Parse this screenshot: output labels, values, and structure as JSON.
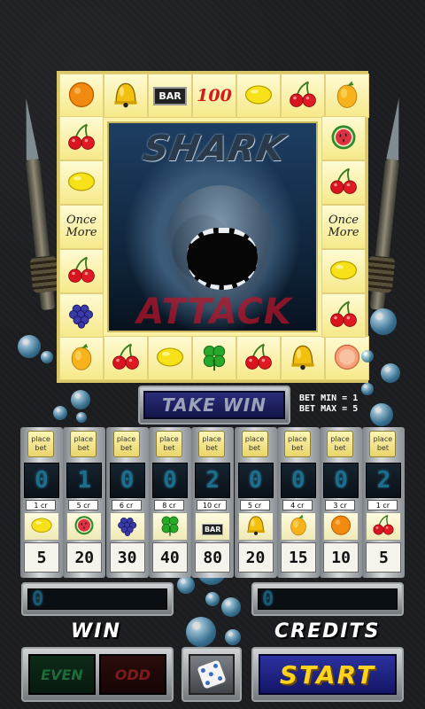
{
  "board": {
    "top": [
      {
        "kind": "icon",
        "icon": "orange-icon"
      },
      {
        "kind": "icon",
        "icon": "bell-icon"
      },
      {
        "kind": "bar",
        "text": "BAR"
      },
      {
        "kind": "num",
        "text": "100"
      },
      {
        "kind": "icon",
        "icon": "lemon-icon"
      },
      {
        "kind": "icon",
        "icon": "cherry-icon"
      },
      {
        "kind": "icon",
        "icon": "mango-icon"
      }
    ],
    "left": [
      {
        "kind": "icon",
        "icon": "cherry-icon"
      },
      {
        "kind": "icon",
        "icon": "lemon-icon"
      },
      {
        "kind": "text",
        "text": "Once More"
      },
      {
        "kind": "icon",
        "icon": "cherry-icon"
      },
      {
        "kind": "icon",
        "icon": "grapes-icon"
      }
    ],
    "right": [
      {
        "kind": "icon",
        "icon": "watermelon-icon"
      },
      {
        "kind": "icon",
        "icon": "cherry-icon"
      },
      {
        "kind": "text",
        "text": "Once More"
      },
      {
        "kind": "icon",
        "icon": "lemon-icon"
      },
      {
        "kind": "icon",
        "icon": "cherry-icon"
      }
    ],
    "bottom": [
      {
        "kind": "icon",
        "icon": "mango-icon"
      },
      {
        "kind": "icon",
        "icon": "cherry-icon"
      },
      {
        "kind": "icon",
        "icon": "lemon-icon"
      },
      {
        "kind": "icon",
        "icon": "clover-icon"
      },
      {
        "kind": "icon",
        "icon": "cherry-icon"
      },
      {
        "kind": "icon",
        "icon": "bell-icon"
      },
      {
        "kind": "icon",
        "icon": "grapefruit-icon"
      }
    ],
    "title_top": "SHARK",
    "title_bottom": "ATTACK"
  },
  "controls": {
    "take_win": "TAKE WIN",
    "bet_min": "BET MIN = 1",
    "bet_max": "BET MAX = 5",
    "place_bet": "place bet",
    "win_value": "0",
    "credits_value": "0",
    "win_label": "WIN",
    "credits_label": "CREDITS",
    "even_label": "EVEN",
    "odd_label": "ODD",
    "start_label": "START"
  },
  "columns": [
    {
      "bet": "0",
      "cr": "1 cr",
      "icon": "lemon-icon",
      "pay": "5"
    },
    {
      "bet": "1",
      "cr": "5 cr",
      "icon": "watermelon-icon",
      "pay": "20"
    },
    {
      "bet": "0",
      "cr": "6 cr",
      "icon": "grapes-icon",
      "pay": "30"
    },
    {
      "bet": "0",
      "cr": "8 cr",
      "icon": "clover-icon",
      "pay": "40"
    },
    {
      "bet": "2",
      "cr": "10 cr",
      "icon": "bar-icon",
      "pay": "80"
    },
    {
      "bet": "0",
      "cr": "5 cr",
      "icon": "bell-icon",
      "pay": "20"
    },
    {
      "bet": "0",
      "cr": "4 cr",
      "icon": "mango-icon",
      "pay": "15"
    },
    {
      "bet": "0",
      "cr": "3 cr",
      "icon": "orange-icon",
      "pay": "10"
    },
    {
      "bet": "2",
      "cr": "1 cr",
      "icon": "cherry-icon",
      "pay": "5"
    }
  ],
  "colors": {
    "board_bg": "#fbf2a8",
    "start_text": "#ffd21e",
    "start_bg": "#2c32a0",
    "lcd_digit": "#1c6e8c",
    "attack_text": "#be1428"
  }
}
